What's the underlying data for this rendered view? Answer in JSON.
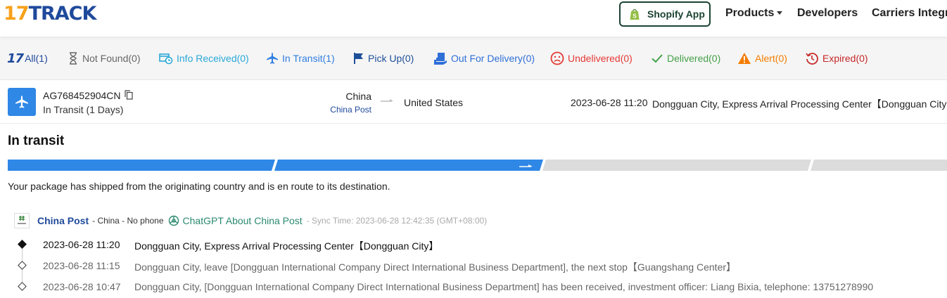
{
  "header": {
    "logo_17": "17",
    "logo_track": "TRACK",
    "shopify_label": "Shopify App",
    "nav": {
      "products": "Products",
      "developers": "Developers",
      "carriers": "Carriers Integr"
    }
  },
  "tabs": {
    "all": "All(1)",
    "not_found": "Not Found(0)",
    "info_received": "Info Received(0)",
    "in_transit": "In Transit(1)",
    "pick_up": "Pick Up(0)",
    "out_for_delivery": "Out For Delivery(0)",
    "undelivered": "Undelivered(0)",
    "delivered": "Delivered(0)",
    "alert": "Alert(0)",
    "expired": "Expired(0)"
  },
  "shipment": {
    "tracking_number": "AG768452904CN",
    "status": "In Transit (1 Days)",
    "origin_country": "China",
    "origin_carrier": "China Post",
    "destination_country": "United States",
    "latest_time": "2023-06-28 11:20",
    "latest_event": "Dongguan City, Express Arrival Processing Center【Dongguan City】"
  },
  "detail": {
    "title": "In transit",
    "progress_completed_segments": 2,
    "progress_total_segments": 4,
    "description": "Your package has shipped from the originating country and is en route to its destination."
  },
  "carrier": {
    "name": "China Post",
    "meta": "- China - No phone",
    "chatgpt_label": "ChatGPT About China Post",
    "sync_time": "- Sync Time: 2023-06-28 12:42:35 (GMT+08:00)"
  },
  "events": [
    {
      "time": "2023-06-28 11:20",
      "text": "Dongguan City, Express Arrival Processing Center【Dongguan City】"
    },
    {
      "time": "2023-06-28 11:15",
      "text": "Dongguan City, leave [Dongguan International Company Direct International Business Department], the next stop【Guangshang Center】"
    },
    {
      "time": "2023-06-28 10:47",
      "text": "Dongguan City, [Dongguan International Company Direct International Business Department] has been received, investment officer: Liang Bixia, telephone: 13751278990"
    }
  ],
  "colors": {
    "brand_blue": "#1f4a9c",
    "brand_orange": "#f8a11b",
    "progress_active": "#2f87e6",
    "progress_inactive": "#dcdcdc"
  }
}
